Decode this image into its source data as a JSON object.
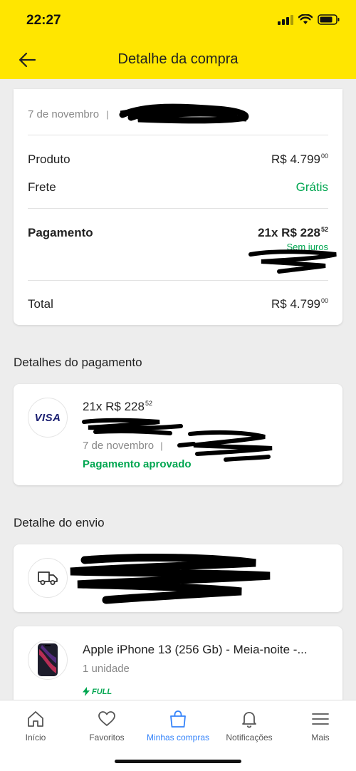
{
  "status_bar": {
    "time": "22:27"
  },
  "nav": {
    "title": "Detalhe da compra"
  },
  "summary": {
    "date": "7 de novembro",
    "separator": "|",
    "product_label": "Produto",
    "product_value": "R$ 4.799",
    "product_cents": "00",
    "shipping_label": "Frete",
    "shipping_value": "Grátis",
    "payment_label": "Pagamento",
    "payment_value": "21x R$ 228",
    "payment_cents": "52",
    "payment_note": "Sem juros",
    "total_label": "Total",
    "total_value": "R$ 4.799",
    "total_cents": "00"
  },
  "payment_details": {
    "title": "Detalhes do pagamento",
    "card_brand": "VISA",
    "amount": "21x R$ 228",
    "amount_cents": "52",
    "date": "7 de novembro",
    "separator": "|",
    "status": "Pagamento aprovado"
  },
  "shipping_details": {
    "title": "Detalhe do envio"
  },
  "item": {
    "name": "Apple iPhone 13 (256 Gb) - Meia-noite -...",
    "quantity": "1 unidade",
    "badge": "FULL"
  },
  "tabbar": {
    "items": [
      {
        "label": "Início",
        "icon": "home-icon"
      },
      {
        "label": "Favoritos",
        "icon": "heart-icon"
      },
      {
        "label": "Minhas compras",
        "icon": "bag-icon"
      },
      {
        "label": "Notificações",
        "icon": "bell-icon"
      },
      {
        "label": "Mais",
        "icon": "menu-icon"
      }
    ],
    "active_index": 2
  },
  "colors": {
    "header": "#ffe600",
    "accent_green": "#00a650",
    "accent_blue": "#3483fa",
    "visa_blue": "#1a1f71"
  }
}
